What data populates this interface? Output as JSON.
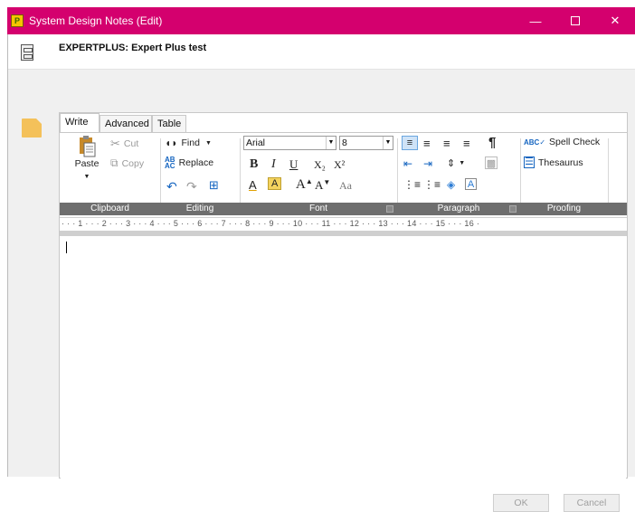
{
  "window": {
    "app_icon": "P",
    "title": "System Design Notes (Edit)",
    "record_title": "EXPERTPLUS: Expert Plus test"
  },
  "tabs": [
    {
      "label": "Write",
      "active": true
    },
    {
      "label": "Advanced",
      "active": false
    },
    {
      "label": "Table",
      "active": false
    }
  ],
  "ribbon": {
    "clipboard": {
      "group_label": "Clipboard",
      "paste": "Paste",
      "cut": "Cut",
      "copy": "Copy"
    },
    "editing": {
      "group_label": "Editing",
      "find": "Find",
      "replace": "Replace"
    },
    "font": {
      "group_label": "Font",
      "font_name": "Arial",
      "font_size": "8",
      "bold": "B",
      "italic": "I",
      "underline": "U",
      "subscript": "X₂",
      "superscript": "X²",
      "grow": "A",
      "shrink": "A",
      "case": "Aa"
    },
    "paragraph": {
      "group_label": "Paragraph",
      "show_marks": "¶"
    },
    "proofing": {
      "group_label": "Proofing",
      "spell_check": "Spell Check",
      "thesaurus": "Thesaurus"
    }
  },
  "ruler": {
    "marks": "· · · 1 · · · 2 · · · 3 · · · 4 · · · 5 · · · 6 · · · 7 · · · 8 · · · 9 · · · 10 · · · 11 · · · 12 · · · 13 · · · 14 · · · 15 · · · 16 ·"
  },
  "footer": {
    "ok": "OK",
    "cancel": "Cancel"
  },
  "colors": {
    "titlebar": "#d4006e",
    "group_bar": "#6e6e6e",
    "folder": "#f4c15a"
  }
}
